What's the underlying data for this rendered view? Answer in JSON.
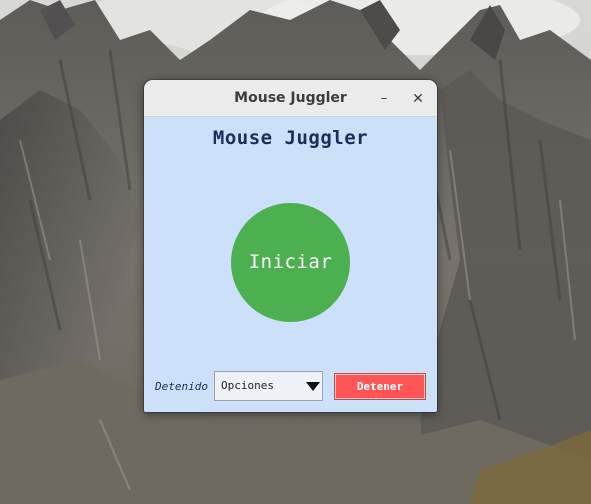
{
  "window": {
    "title": "Mouse Juggler",
    "minimize_glyph": "–",
    "close_glyph": "✕"
  },
  "app": {
    "heading": "Mouse Juggler",
    "start_label": "Iniciar",
    "status": "Detenido",
    "options_selected": "Opciones",
    "stop_label": "Detener"
  },
  "icons": {
    "minimize": "minimize-icon",
    "close": "close-icon",
    "dropdown": "triangle-down-icon"
  },
  "colors": {
    "window_background": "#cce0fa",
    "titlebar": "#ebebeb",
    "heading_text": "#1b2f5a",
    "start_button": "#4caf50",
    "stop_button": "#ff5555"
  }
}
